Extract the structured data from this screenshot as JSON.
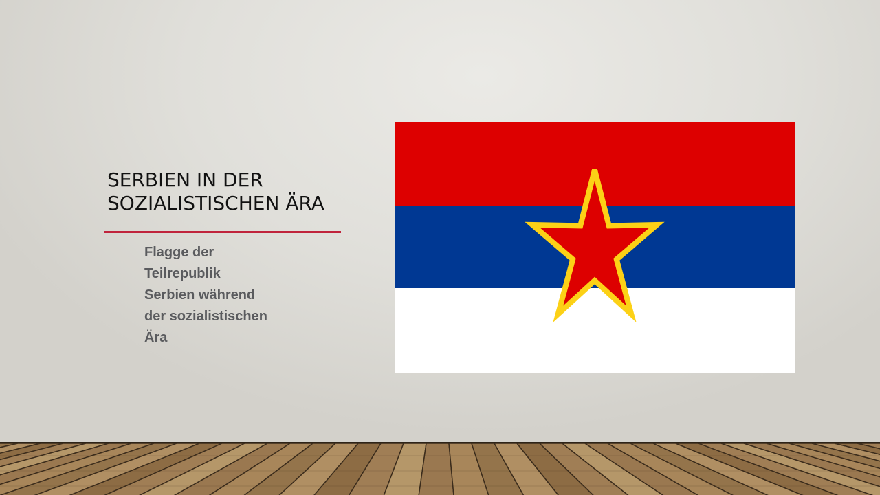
{
  "slide": {
    "title_lines": [
      "Serbien in der",
      "sozialistischen Ära"
    ],
    "caption_lines": [
      "Flagge der",
      "Teilrepublik",
      "Serbien während",
      "der sozialistischen",
      "Ära"
    ],
    "accent_color": "#c0243c"
  },
  "flag": {
    "stripe_colors": [
      "#dd0000",
      "#003893",
      "#ffffff"
    ],
    "star_fill": "#dd0000",
    "star_outline": "#fcd116"
  },
  "floor": {
    "base_color": "#9c7c52",
    "gap_color": "#3b2c1c"
  }
}
